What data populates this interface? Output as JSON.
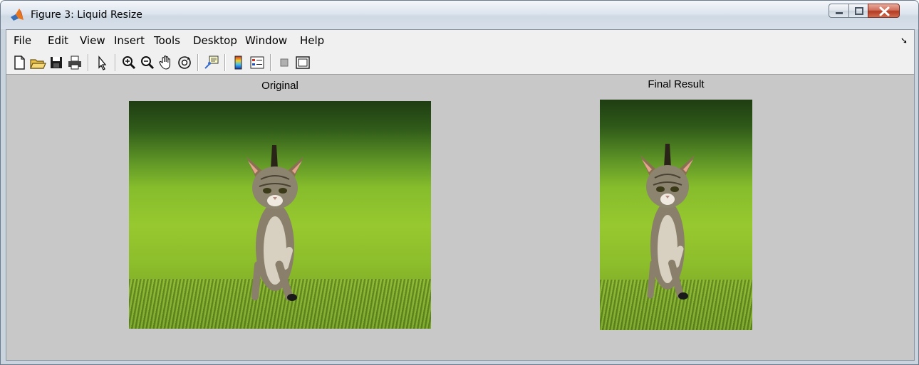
{
  "window": {
    "title": "Figure 3: Liquid Resize",
    "icon": "matlab-icon",
    "controls": [
      "minimize-icon",
      "maximize-icon",
      "close-icon"
    ]
  },
  "menubar": {
    "items": [
      {
        "label": "File"
      },
      {
        "label": "Edit"
      },
      {
        "label": "View"
      },
      {
        "label": "Insert"
      },
      {
        "label": "Tools"
      },
      {
        "label": "Desktop"
      },
      {
        "label": "Window"
      },
      {
        "label": "Help"
      }
    ],
    "dock_icon": "dock-arrow-icon"
  },
  "toolbar": {
    "buttons": [
      "new-figure-icon",
      "open-file-icon",
      "save-figure-icon",
      "print-figure-icon",
      "edit-plot-icon",
      "zoom-in-icon",
      "zoom-out-icon",
      "pan-icon",
      "rotate-3d-icon",
      "data-cursor-icon",
      "insert-colorbar-icon",
      "insert-legend-icon",
      "hide-plot-tools-icon",
      "show-plot-tools-icon"
    ]
  },
  "figure": {
    "left_axes": {
      "title": "Original",
      "image": "kitten-photo-original"
    },
    "right_axes": {
      "title": "Final Result",
      "image": "kitten-photo-resized"
    }
  },
  "colors": {
    "figure_background": "#c8c8c8",
    "menubar_background": "#f0f0f0",
    "grass": "#8cbd2b"
  }
}
